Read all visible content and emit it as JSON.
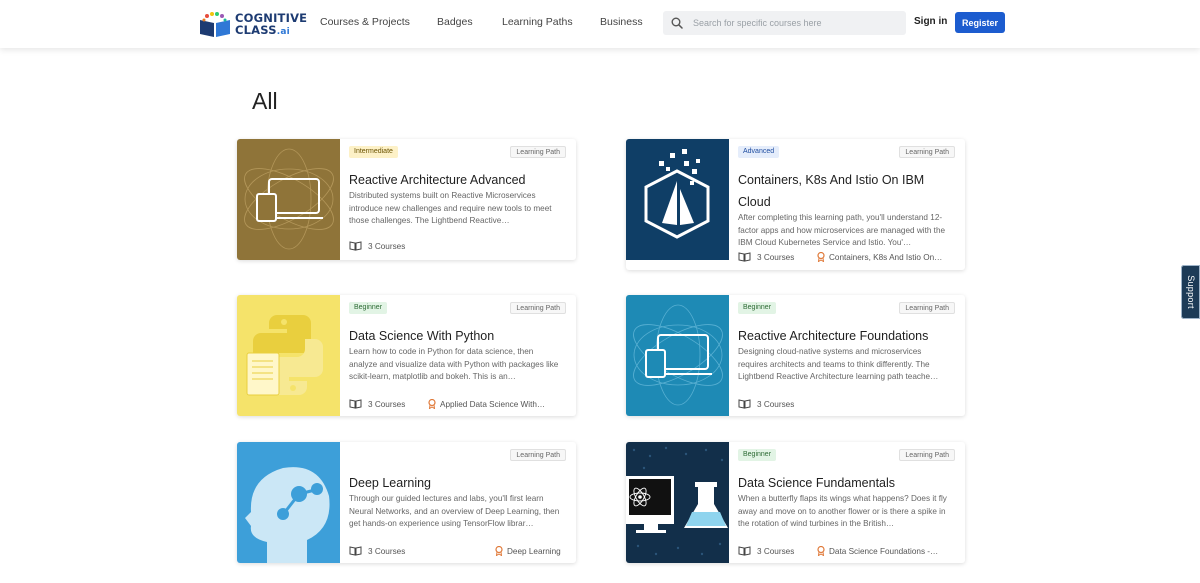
{
  "header": {
    "logo": {
      "line1": "COGNITIVE",
      "line2": "CLASS",
      "suffix": ".ai"
    },
    "nav": [
      "Courses & Projects",
      "Badges",
      "Learning Paths",
      "Business"
    ],
    "search_placeholder": "Search for specific courses here",
    "signin": "Sign in",
    "register": "Register"
  },
  "page": {
    "title": "All"
  },
  "colors": {
    "accent": "#1c5ccf",
    "brand": "#1d3b72"
  },
  "cards": [
    {
      "level": "Intermediate",
      "type": "Learning Path",
      "title": "Reactive Architecture Advanced",
      "description": "Distributed systems built on Reactive Microservices introduce new challenges and require new tools to meet those challenges. The Lightbend Reactive…",
      "courses": "3 Courses",
      "badge": "",
      "thumb_color": "#8f7439"
    },
    {
      "level": "Advanced",
      "type": "Learning Path",
      "title": "Containers, K8s And Istio On IBM Cloud",
      "description": "After completing this learning path, you'll understand 12-factor apps and how microservices are managed with the IBM Cloud Kubernetes Service and Istio. You'…",
      "courses": "3 Courses",
      "badge": "Containers, K8s And Istio On…",
      "thumb_color": "#0f3e66"
    },
    {
      "level": "Beginner",
      "type": "Learning Path",
      "title": "Data Science With Python",
      "description": "Learn how to code in Python for data science, then analyze and visualize data with Python with packages like scikit-learn, matplotlib and bokeh. This is an…",
      "courses": "3 Courses",
      "badge": "Applied Data Science With…",
      "thumb_color": "#f5e36a"
    },
    {
      "level": "Beginner",
      "type": "Learning Path",
      "title": "Reactive Architecture Foundations",
      "description": "Designing cloud-native systems and microservices requires architects and teams to think differently. The Lightbend Reactive Architecture learning path teache…",
      "courses": "3 Courses",
      "badge": "",
      "thumb_color": "#1e8ab5"
    },
    {
      "level": "",
      "type": "Learning Path",
      "title": "Deep Learning",
      "description": "Through our guided lectures and labs, you'll first learn Neural Networks, and an overview of Deep Learning, then get hands-on experience using TensorFlow librar…",
      "courses": "3 Courses",
      "badge": "Deep Learning",
      "thumb_color": "#3d9fd9"
    },
    {
      "level": "Beginner",
      "type": "Learning Path",
      "title": "Data Science Fundamentals",
      "description": "When a butterfly flaps its wings what happens? Does it fly away and move on to another flower or is there a spike in the rotation of wind turbines in the British…",
      "courses": "3 Courses",
      "badge": "Data Science Foundations -…",
      "thumb_color": "#122f4a"
    }
  ],
  "support_tab": "Support"
}
